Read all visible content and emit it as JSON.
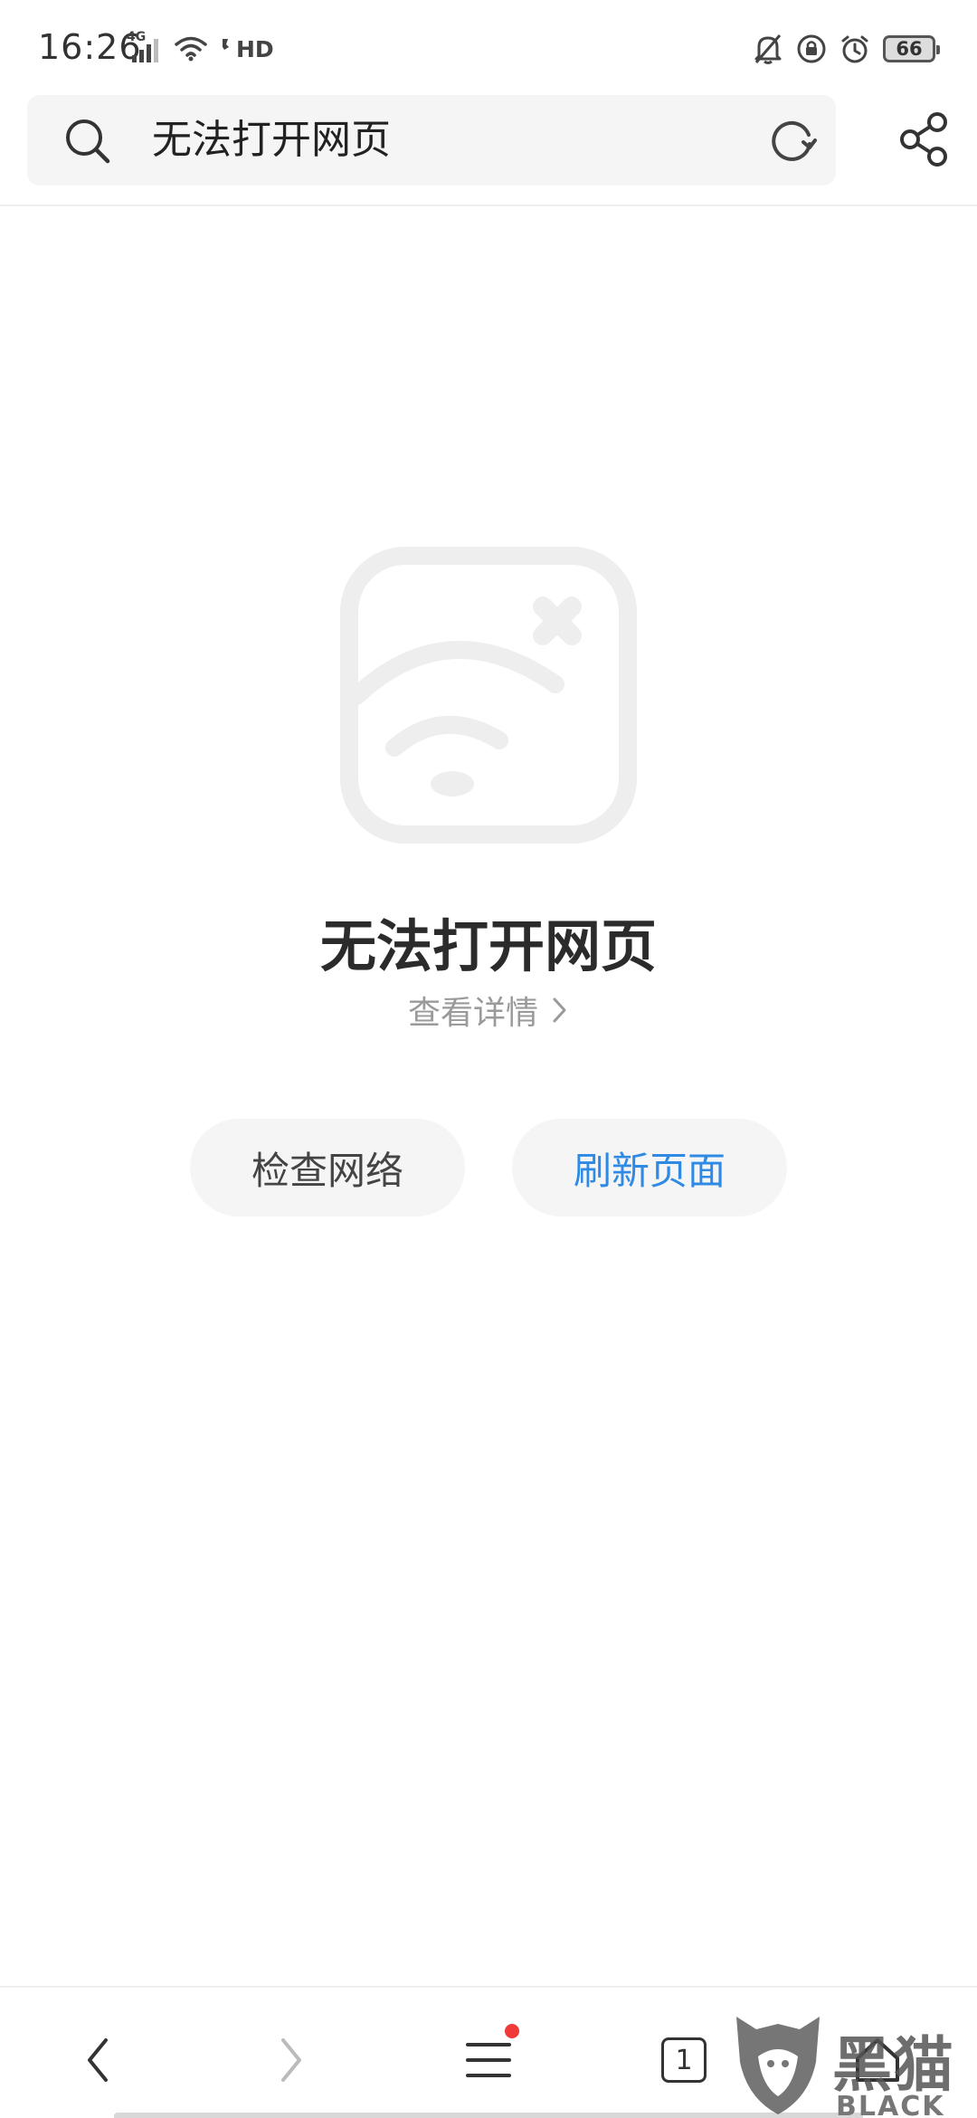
{
  "status_bar": {
    "time": "16:26",
    "network": "4G",
    "hd": "HD",
    "battery": "66",
    "icons": [
      "signal-icon",
      "wifi-icon",
      "hd-call-icon",
      "bell-off-icon",
      "rotation-lock-icon",
      "alarm-icon",
      "battery-icon"
    ]
  },
  "address_bar": {
    "title": "无法打开网页",
    "icons": [
      "search-icon",
      "reload-icon",
      "share-icon"
    ]
  },
  "error": {
    "illustration": "no-connection-icon",
    "title": "无法打开网页",
    "details_label": "查看详情"
  },
  "buttons": {
    "check_network": "检查网络",
    "refresh_page": "刷新页面"
  },
  "bottom_nav": {
    "tab_count": "1",
    "icons": [
      "back-icon",
      "forward-icon",
      "menu-icon",
      "tabs-icon",
      "home-icon"
    ]
  },
  "watermark": {
    "brand_cn": "黑猫",
    "brand_en": "BLACK CAT"
  },
  "colors": {
    "accent": "#2f8ae5",
    "badge": "#f03a3a",
    "illustration": "#eeeeee"
  }
}
